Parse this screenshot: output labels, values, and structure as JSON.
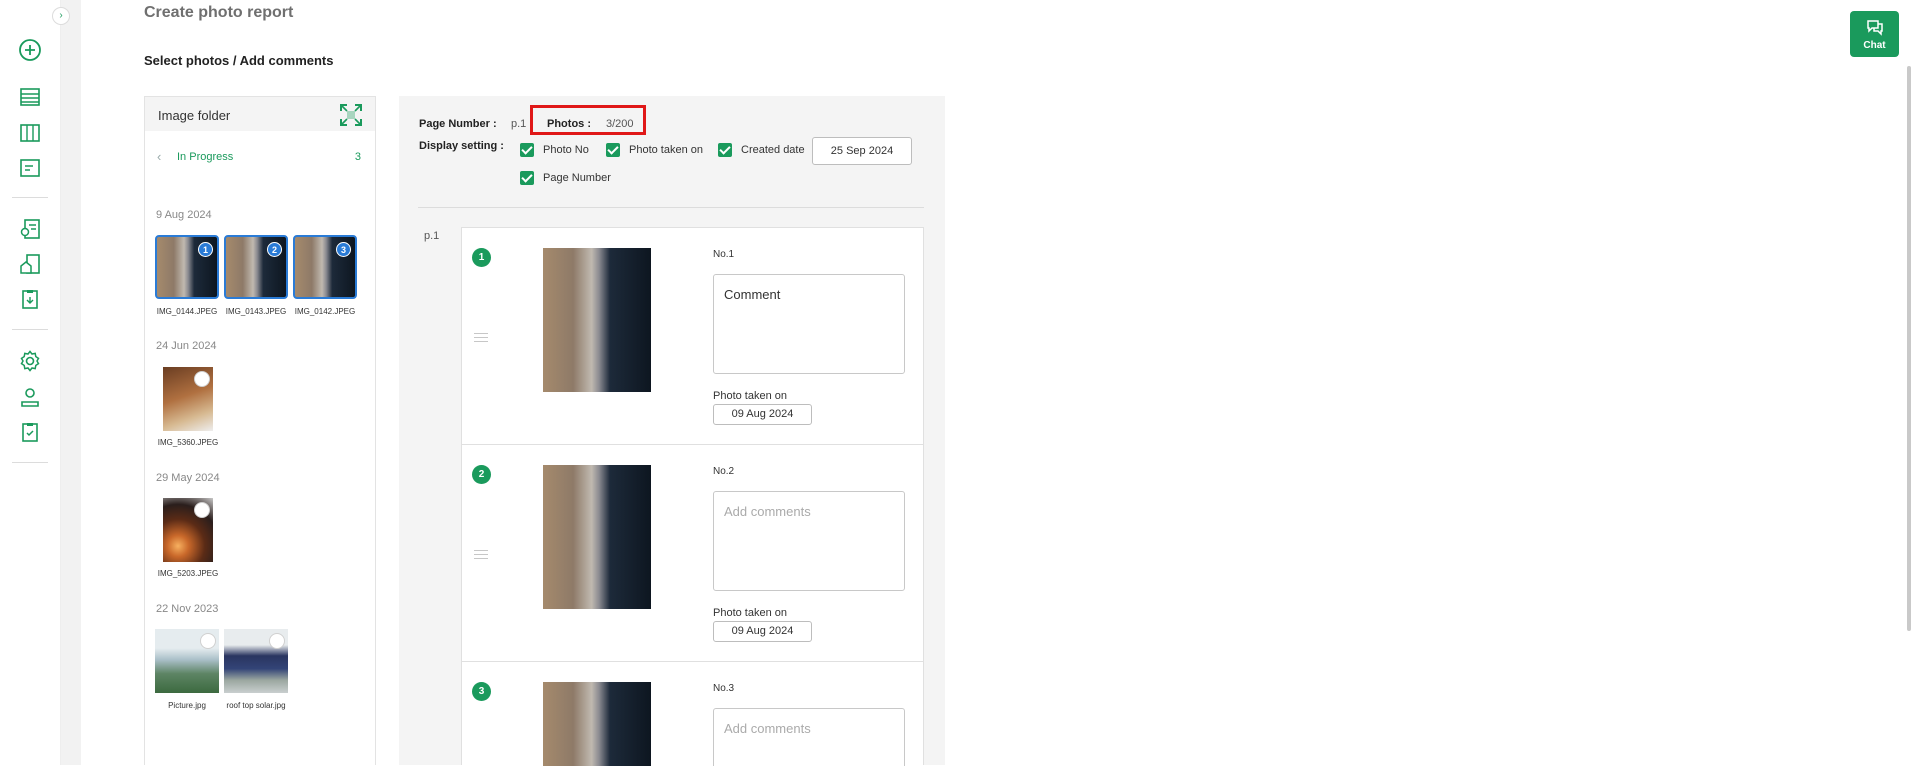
{
  "header": {
    "title": "Create photo report",
    "section": "Select photos / Add comments"
  },
  "sidebar": {
    "toggle_glyph": "›",
    "icons": [
      "add-icon",
      "list-icon",
      "board-icon",
      "card-icon",
      "report-icon",
      "home-report-icon",
      "clipboard-download-icon",
      "settings-icon",
      "user-icon",
      "checklist-icon"
    ]
  },
  "folder": {
    "title": "Image folder",
    "status_label": "In Progress",
    "status_count": "3",
    "groups": [
      {
        "date": "9 Aug 2024",
        "items": [
          {
            "name": "IMG_0144.JPEG",
            "badge": "1"
          },
          {
            "name": "IMG_0143.JPEG",
            "badge": "2"
          },
          {
            "name": "IMG_0142.JPEG",
            "badge": "3"
          }
        ]
      },
      {
        "date": "24 Jun 2024",
        "items": [
          {
            "name": "IMG_5360.JPEG"
          }
        ]
      },
      {
        "date": "29 May 2024",
        "items": [
          {
            "name": "IMG_5203.JPEG"
          }
        ]
      },
      {
        "date": "22 Nov 2023",
        "items": [
          {
            "name": "Picture.jpg"
          },
          {
            "name": "roof top solar.jpg"
          }
        ]
      }
    ]
  },
  "report": {
    "page_number_label": "Page Number :",
    "page_number_value": "p.1",
    "photos_label": "Photos :",
    "photos_value": "3/200",
    "display_setting_label": "Display setting :",
    "settings": [
      "Photo No",
      "Photo taken on",
      "Created date",
      "Page Number"
    ],
    "created_date": "25 Sep 2024",
    "page_label": "p.1",
    "taken_label": "Photo taken on",
    "cards": [
      {
        "num": "1",
        "no_label": "No.1",
        "comment": "Comment",
        "placeholder": false,
        "taken": "09 Aug 2024"
      },
      {
        "num": "2",
        "no_label": "No.2",
        "comment": "Add comments",
        "placeholder": true,
        "taken": "09 Aug 2024"
      },
      {
        "num": "3",
        "no_label": "No.3",
        "comment": "Add comments",
        "placeholder": true,
        "taken": ""
      }
    ]
  },
  "chat": {
    "label": "Chat"
  },
  "colors": {
    "brand": "#1a9a5c",
    "selected": "#2a7bd6",
    "highlight": "#e01818"
  }
}
